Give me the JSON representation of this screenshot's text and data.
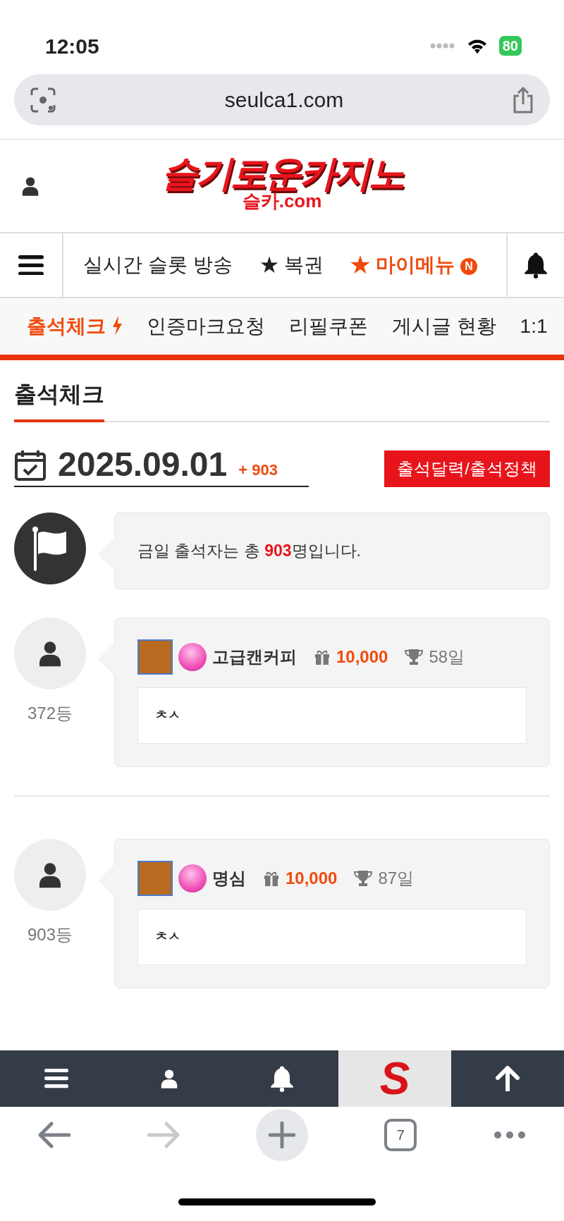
{
  "status_bar": {
    "time": "12:05",
    "battery": "80"
  },
  "browser": {
    "url": "seulca1.com",
    "tab_count": "7"
  },
  "site": {
    "logo_title": "슬기로운카지노",
    "logo_subtitle": "슬카.com"
  },
  "menu": [
    {
      "label": "실시간 슬롯 방송",
      "highlighted": false
    },
    {
      "label": "★ 복권",
      "highlighted": false
    },
    {
      "label": "★ 마이메뉴",
      "highlighted": true,
      "badge": "N"
    }
  ],
  "subnav": [
    {
      "label": "출석체크",
      "selected": true
    },
    {
      "label": "인증마크요청",
      "selected": false
    },
    {
      "label": "리필쿠폰",
      "selected": false
    },
    {
      "label": "게시글 현황",
      "selected": false
    },
    {
      "label": "1:1",
      "selected": false
    }
  ],
  "page_title": "출석체크",
  "date": "2025.09.01",
  "count": "+ 903",
  "calendar_button": "출석달력/출석정책",
  "notice": "금일 출석자는 총 **903**명입니다.",
  "entries": [
    {
      "rank": "372등",
      "name": "고급캔커피",
      "points": "10,000",
      "days": "58일",
      "comment": "ㅊㅅ"
    },
    {
      "rank": "903등",
      "name": "명심",
      "points": "10,000",
      "days": "87일",
      "comment": "ㅊㅅ"
    }
  ],
  "bottom_logo": "S"
}
